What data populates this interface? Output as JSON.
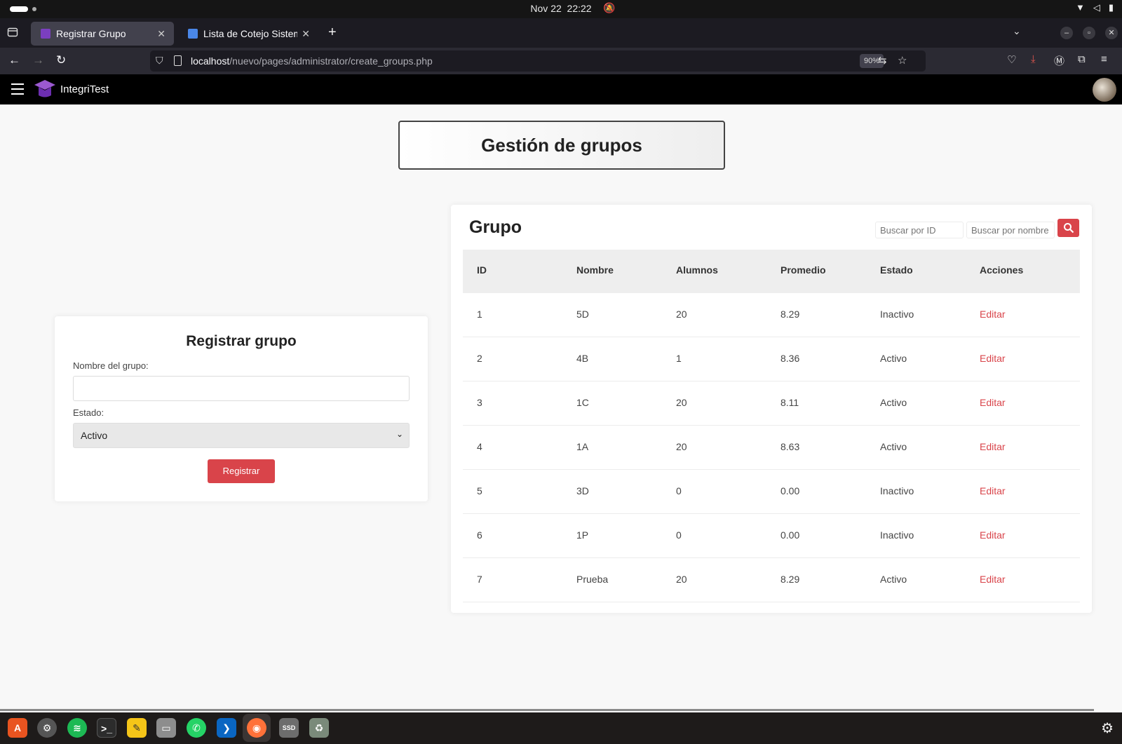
{
  "system_bar": {
    "date": "Nov 22",
    "time": "22:22"
  },
  "browser": {
    "tabs": [
      {
        "title": "Registrar Grupo",
        "active": true
      },
      {
        "title": "Lista de Cotejo Sistema E",
        "active": false
      }
    ],
    "url_host": "localhost",
    "url_path": "/nuevo/pages/administrator/create_groups.php",
    "zoom": "90%"
  },
  "app": {
    "brand": "IntegriTest"
  },
  "page_title": "Gestión de grupos",
  "register_form": {
    "heading": "Registrar grupo",
    "name_label": "Nombre del grupo:",
    "name_value": "",
    "status_label": "Estado:",
    "status_selected": "Activo",
    "submit_label": "Registrar"
  },
  "groups_table": {
    "heading": "Grupo",
    "search_id_placeholder": "Buscar por ID",
    "search_name_placeholder": "Buscar por nombre",
    "columns": [
      "ID",
      "Nombre",
      "Alumnos",
      "Promedio",
      "Estado",
      "Acciones"
    ],
    "rows": [
      {
        "id": "1",
        "nombre": "5D",
        "alumnos": "20",
        "promedio": "8.29",
        "estado": "Inactivo",
        "accion": "Editar"
      },
      {
        "id": "2",
        "nombre": "4B",
        "alumnos": "1",
        "promedio": "8.36",
        "estado": "Activo",
        "accion": "Editar"
      },
      {
        "id": "3",
        "nombre": "1C",
        "alumnos": "20",
        "promedio": "8.11",
        "estado": "Activo",
        "accion": "Editar"
      },
      {
        "id": "4",
        "nombre": "1A",
        "alumnos": "20",
        "promedio": "8.63",
        "estado": "Activo",
        "accion": "Editar"
      },
      {
        "id": "5",
        "nombre": "3D",
        "alumnos": "0",
        "promedio": "0.00",
        "estado": "Inactivo",
        "accion": "Editar"
      },
      {
        "id": "6",
        "nombre": "1P",
        "alumnos": "0",
        "promedio": "0.00",
        "estado": "Inactivo",
        "accion": "Editar"
      },
      {
        "id": "7",
        "nombre": "Prueba",
        "alumnos": "20",
        "promedio": "8.29",
        "estado": "Activo",
        "accion": "Editar"
      }
    ]
  },
  "colors": {
    "accent": "#d9444a",
    "header_bg": "#000000",
    "page_bg": "#f8f8f8"
  },
  "dock": {
    "apps": [
      "app-center-icon",
      "settings-icon",
      "spotify-icon",
      "terminal-icon",
      "text-editor-icon",
      "files-icon",
      "whatsapp-icon",
      "vscode-icon",
      "firefox-icon",
      "ssd-icon",
      "trash-icon"
    ]
  }
}
